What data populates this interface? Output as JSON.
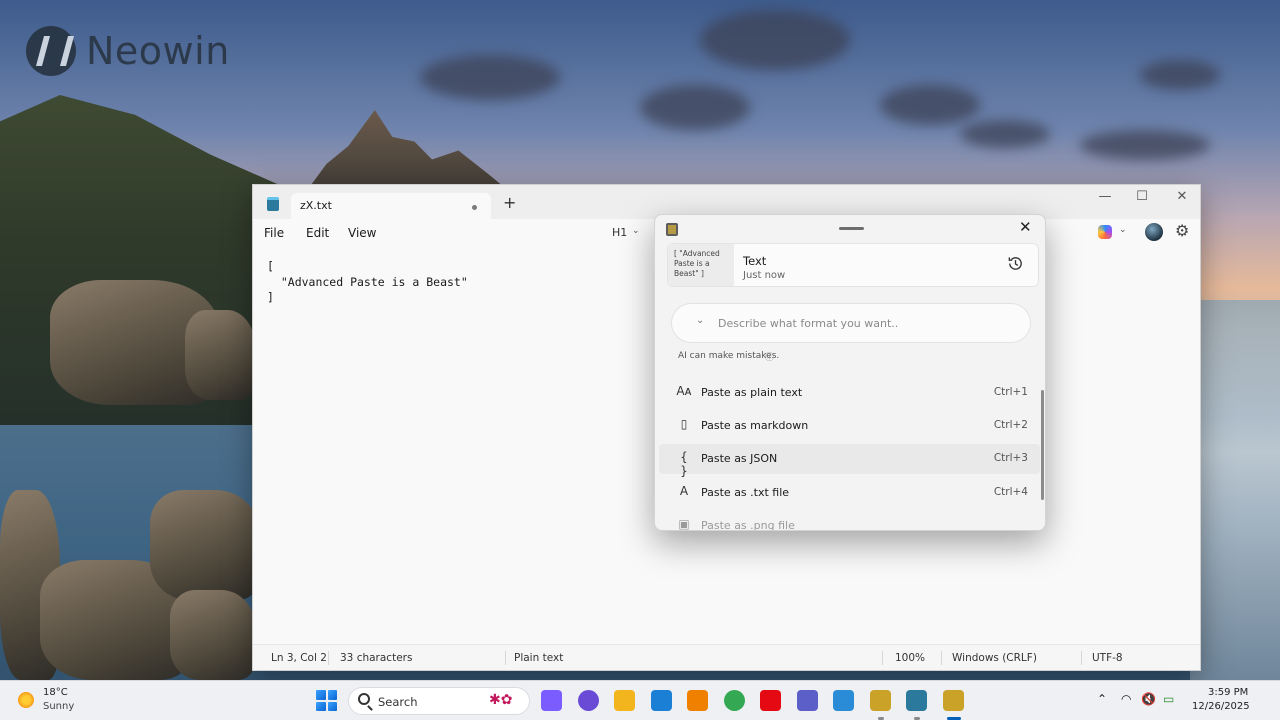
{
  "desktop": {
    "logo_text": "Neowin"
  },
  "notepad": {
    "tab_title": "zX.txt",
    "new_tab_symbol": "+",
    "window_controls": {
      "minimize": "—",
      "maximize": "☐",
      "close": "✕"
    },
    "menu": {
      "file": "File",
      "edit": "Edit",
      "view": "View"
    },
    "heading_select": "H1",
    "editor_lines": [
      "[",
      "  \"Advanced Paste is a Beast\"",
      "]"
    ],
    "status": {
      "position": "Ln 3, Col 2",
      "characters": "33 characters",
      "format": "Plain text",
      "zoom": "100%",
      "line_endings": "Windows (CRLF)",
      "encoding": "UTF-8"
    }
  },
  "advanced_paste": {
    "close_symbol": "✕",
    "clipboard_item": {
      "preview": "[ \"Advanced\nPaste is a\nBeast\" ]",
      "type": "Text",
      "time": "Just now"
    },
    "ai_input": {
      "placeholder": "Describe what format you want..",
      "value": ""
    },
    "ai_note": "AI can make mistakes.",
    "options": [
      {
        "icon": "plain-text-icon",
        "glyph": "Aᴀ",
        "label": "Paste as plain text",
        "shortcut": "Ctrl+1"
      },
      {
        "icon": "markdown-icon",
        "glyph": "▯",
        "label": "Paste as markdown",
        "shortcut": "Ctrl+2"
      },
      {
        "icon": "json-icon",
        "glyph": "{ }",
        "label": "Paste as JSON",
        "shortcut": "Ctrl+3"
      },
      {
        "icon": "txt-file-icon",
        "glyph": "A",
        "label": "Paste as .txt file",
        "shortcut": "Ctrl+4"
      },
      {
        "icon": "image-file-icon",
        "glyph": "▣",
        "label": "Paste as .png file",
        "shortcut": ""
      }
    ],
    "hovered_option_index": 2
  },
  "taskbar": {
    "weather": {
      "temp": "18°C",
      "condition": "Sunny"
    },
    "search_label": "Search",
    "pinned_apps": [
      {
        "name": "copilot",
        "color": "#7b5cff"
      },
      {
        "name": "browser-swirl",
        "color": "#6a4bd6"
      },
      {
        "name": "file-explorer",
        "color": "#f2b51d"
      },
      {
        "name": "photos",
        "color": "#1c7fd6"
      },
      {
        "name": "vlc",
        "color": "#f08000"
      },
      {
        "name": "chrome",
        "color": "#34a853"
      },
      {
        "name": "netflix",
        "color": "#e50914"
      },
      {
        "name": "teams",
        "color": "#5b5fc7"
      },
      {
        "name": "snipping-tool",
        "color": "#2a8cd6"
      },
      {
        "name": "powertoys",
        "color": "#c9a227"
      },
      {
        "name": "notepad",
        "color": "#2b7a9e"
      },
      {
        "name": "advanced-paste",
        "color": "#c9a227"
      }
    ],
    "tray": {
      "chevron": "⌃",
      "wifi": "◠",
      "volume": "🔇",
      "battery": "▭"
    },
    "clock": {
      "time": "3:59 PM",
      "date": "12/26/2025"
    }
  }
}
